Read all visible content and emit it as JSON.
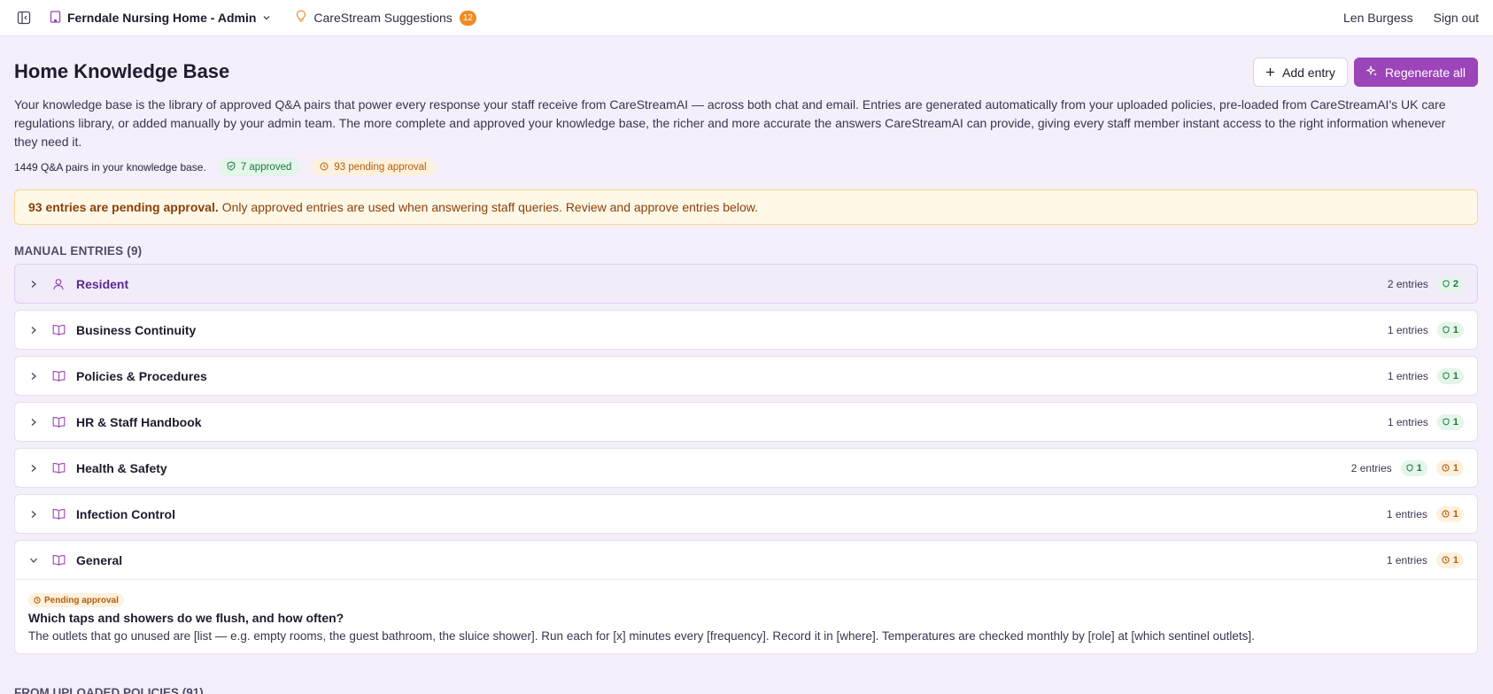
{
  "topbar": {
    "org_name": "Ferndale Nursing Home - Admin",
    "suggestions_label": "CareStream Suggestions",
    "suggestions_count": "12",
    "user_name": "Len Burgess",
    "sign_out": "Sign out"
  },
  "page": {
    "title": "Home Knowledge Base",
    "add_entry_label": "Add entry",
    "regenerate_label": "Regenerate all",
    "intro": "Your knowledge base is the library of approved Q&A pairs that power every response your staff receive from CareStreamAI — across both chat and email. Entries are generated automatically from your uploaded policies, pre-loaded from CareStreamAI's UK care regulations library, or added manually by your admin team. The more complete and approved your knowledge base, the richer and more accurate the answers CareStreamAI can provide, giving every staff member instant access to the right information whenever they need it.",
    "stats_text": "1449 Q&A pairs in your knowledge base.",
    "approved_pill": "7 approved",
    "pending_pill": "93 pending approval"
  },
  "alert": {
    "bold": "93 entries are pending approval.",
    "text": "Only approved entries are used when answering staff queries. Review and approve entries below."
  },
  "manual": {
    "title": "MANUAL ENTRIES (9)",
    "groups": [
      {
        "label": "Resident",
        "entries": "2 entries",
        "approved": "2",
        "pending": ""
      },
      {
        "label": "Business Continuity",
        "entries": "1 entries",
        "approved": "1",
        "pending": ""
      },
      {
        "label": "Policies & Procedures",
        "entries": "1 entries",
        "approved": "1",
        "pending": ""
      },
      {
        "label": "HR & Staff Handbook",
        "entries": "1 entries",
        "approved": "1",
        "pending": ""
      },
      {
        "label": "Health & Safety",
        "entries": "2 entries",
        "approved": "1",
        "pending": "1"
      },
      {
        "label": "Infection Control",
        "entries": "1 entries",
        "approved": "",
        "pending": "1"
      },
      {
        "label": "General",
        "entries": "1 entries",
        "approved": "",
        "pending": "1"
      }
    ],
    "general_entry": {
      "status": "Pending approval",
      "question": "Which taps and showers do we flush, and how often?",
      "answer": "The outlets that go unused are [list — e.g. empty rooms, the guest bathroom, the sluice shower]. Run each for [x] minutes every [frequency]. Record it in [where]. Temperatures are checked monthly by [role] at [which sentinel outlets]."
    }
  },
  "uploaded": {
    "title": "FROM UPLOADED POLICIES (91)"
  },
  "colors": {
    "accent": "#9b45b8",
    "approved": "#1b7a3e",
    "pending": "#b45d0a",
    "background": "#f4effa"
  }
}
